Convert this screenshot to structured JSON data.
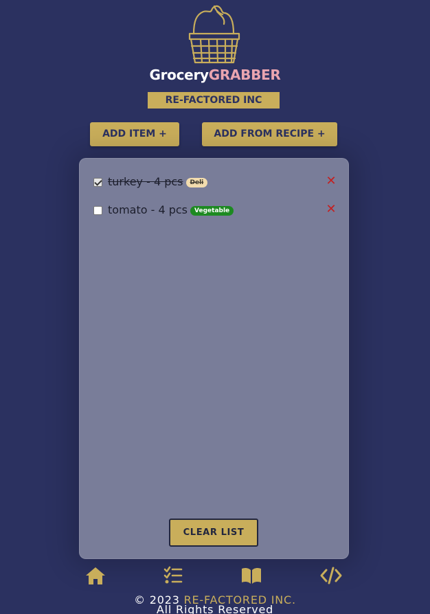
{
  "logo": {
    "word1": "Grocery",
    "word2": "GRABBER",
    "company": "RE-FACTORED INC",
    "accent_color": "#c9ae5b",
    "basket_icon": "shopping-basket-icon"
  },
  "actions": {
    "add_item": "ADD ITEM +",
    "add_from_recipe": "ADD FROM RECIPE +"
  },
  "grocery_list": {
    "items": [
      {
        "text": "turkey - 4 pcs",
        "category": "Deli",
        "checked": true,
        "category_color": "#f2dcae"
      },
      {
        "text": "tomato - 4 pcs",
        "category": "Vegetable",
        "checked": false,
        "category_color": "#1d8a21"
      }
    ],
    "remove_icon": "close-icon",
    "clear_label": "CLEAR LIST"
  },
  "nav": {
    "icons": [
      "home-icon",
      "checklist-icon",
      "book-icon",
      "code-icon"
    ]
  },
  "footer": {
    "copyright": "© 2023",
    "company": "RE-FACTORED INC.",
    "rights": "All Rights Reserved"
  }
}
